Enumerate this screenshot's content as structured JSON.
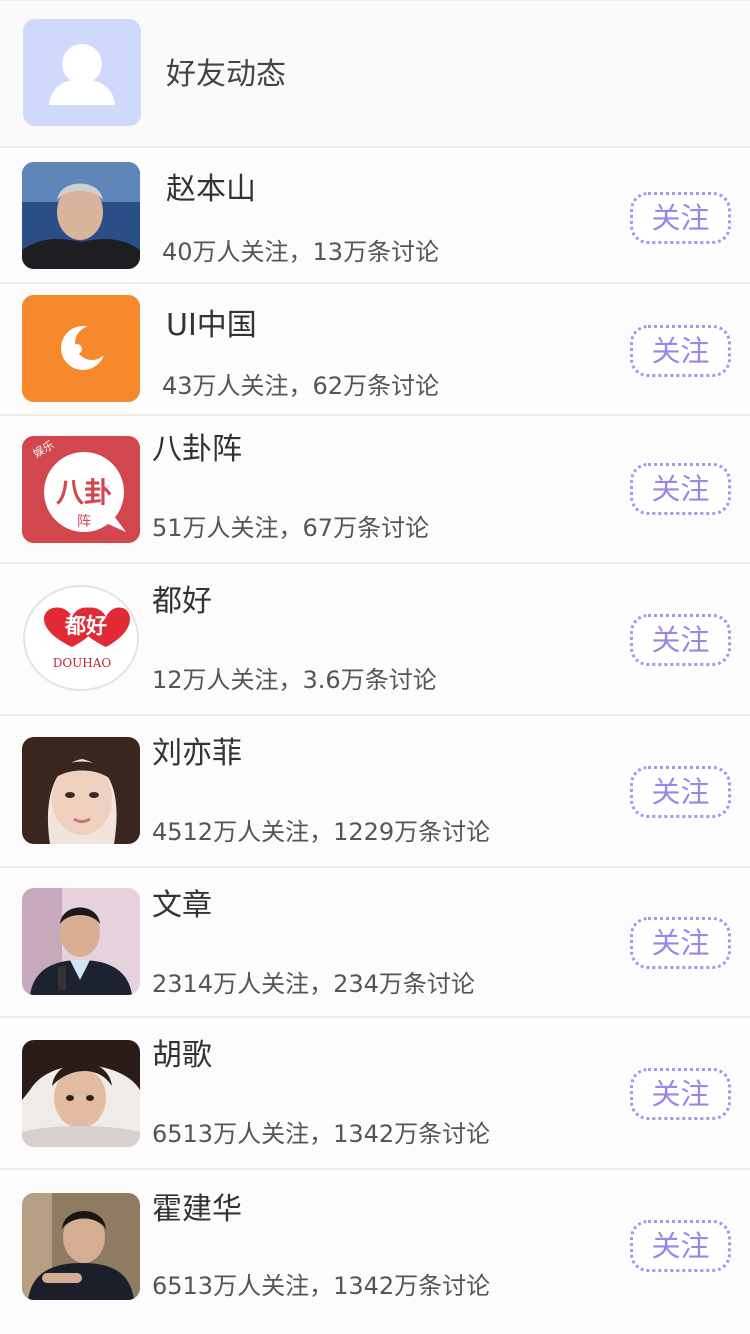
{
  "header": {
    "title": "好友动态"
  },
  "list": [
    {
      "name": "赵本山",
      "stats": "40万人关注，13万条讨论",
      "follow_label": "关注"
    },
    {
      "name": "UI中国",
      "stats": "43万人关注，62万条讨论",
      "follow_label": "关注"
    },
    {
      "name": "八卦阵",
      "stats": "51万人关注，67万条讨论",
      "follow_label": "关注",
      "logo_text": "八卦",
      "logo_sub": "阵",
      "logo_tag": "娱乐"
    },
    {
      "name": "都好",
      "stats": "12万人关注，3.6万条讨论",
      "follow_label": "关注",
      "logo_text": "都好",
      "logo_sub": "DOUHAO"
    },
    {
      "name": "刘亦菲",
      "stats": "4512万人关注，1229万条讨论",
      "follow_label": "关注"
    },
    {
      "name": "文章",
      "stats": "2314万人关注，234万条讨论",
      "follow_label": "关注"
    },
    {
      "name": "胡歌",
      "stats": "6513万人关注，1342万条讨论",
      "follow_label": "关注"
    },
    {
      "name": "霍建华",
      "stats": "6513万人关注，1342万条讨论",
      "follow_label": "关注"
    }
  ],
  "colors": {
    "accent": "#9a86e6",
    "friend_avatar_bg": "#cfd9fb",
    "ui_china_orange": "#f7892d",
    "bagua_red": "#d2474e"
  },
  "icons": {
    "friend_avatar": "person-silhouette-icon",
    "ui_china": "crescent-logo-icon"
  }
}
